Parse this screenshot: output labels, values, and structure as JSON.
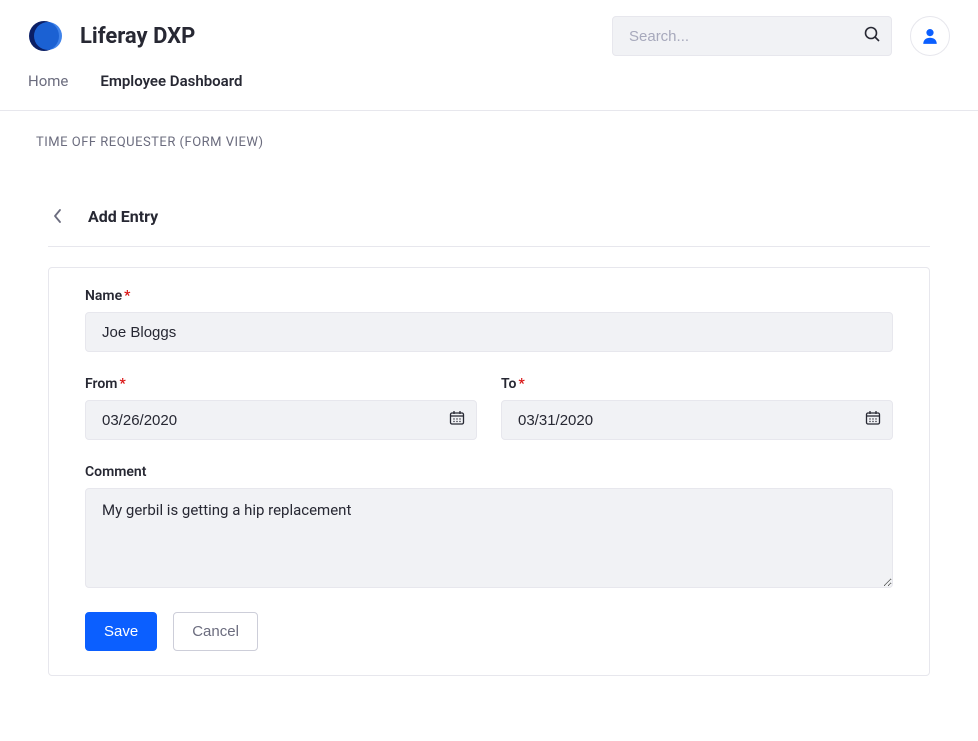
{
  "header": {
    "brand": "Liferay DXP",
    "search_placeholder": "Search..."
  },
  "nav": {
    "home": "Home",
    "dashboard": "Employee Dashboard"
  },
  "page": {
    "title": "TIME OFF REQUESTER (FORM VIEW)"
  },
  "form": {
    "title": "Add Entry",
    "labels": {
      "name": "Name",
      "from": "From",
      "to": "To",
      "comment": "Comment"
    },
    "values": {
      "name": "Joe Bloggs",
      "from": "03/26/2020",
      "to": "03/31/2020",
      "comment": "My gerbil is getting a hip replacement"
    },
    "buttons": {
      "save": "Save",
      "cancel": "Cancel"
    }
  }
}
